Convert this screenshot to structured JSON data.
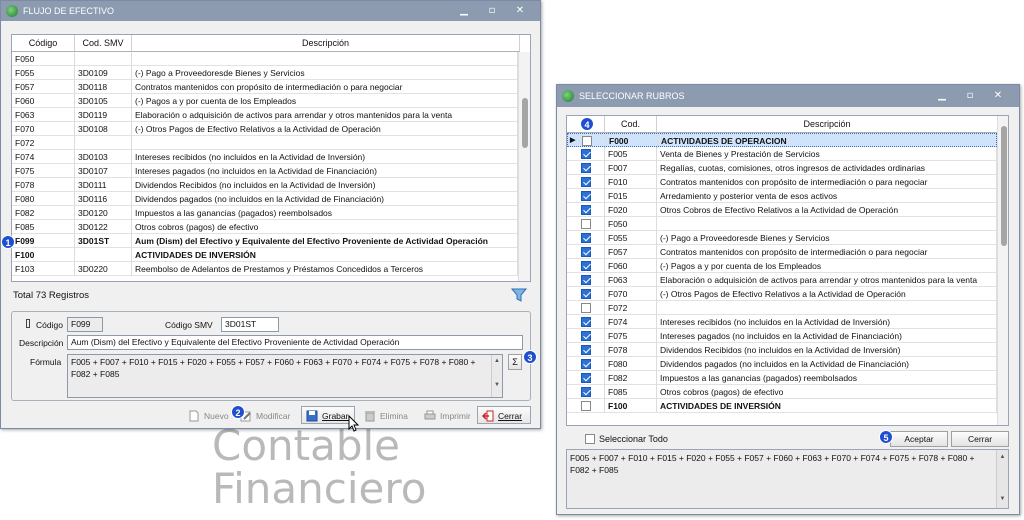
{
  "win1": {
    "title": "FLUJO DE EFECTIVO",
    "columns": [
      "Código",
      "Cod. SMV",
      "Descripción"
    ],
    "rows": [
      {
        "code": "F050",
        "smv": "",
        "desc": "",
        "bold": false
      },
      {
        "code": "F055",
        "smv": "3D0109",
        "desc": "(-) Pago a Proveedoresde Bienes y Servicios",
        "bold": false
      },
      {
        "code": "F057",
        "smv": "3D0118",
        "desc": "Contratos mantenidos con propósito de intermediación o para negociar",
        "bold": false
      },
      {
        "code": "F060",
        "smv": "3D0105",
        "desc": "(-) Pagos a y por cuenta de los Empleados",
        "bold": false
      },
      {
        "code": "F063",
        "smv": "3D0119",
        "desc": "Elaboración o adquisición de activos para arrendar y otros mantenidos para la venta",
        "bold": false
      },
      {
        "code": "F070",
        "smv": "3D0108",
        "desc": "(-) Otros Pagos de Efectivo Relativos a la Actividad de Operación",
        "bold": false
      },
      {
        "code": "F072",
        "smv": "",
        "desc": "",
        "bold": false
      },
      {
        "code": "F074",
        "smv": "3D0103",
        "desc": "Intereses recibidos (no incluidos en la Actividad de Inversión)",
        "bold": false
      },
      {
        "code": "F075",
        "smv": "3D0107",
        "desc": "Intereses pagados (no incluidos en la Actividad de Financiación)",
        "bold": false
      },
      {
        "code": "F078",
        "smv": "3D0111",
        "desc": "Dividendos Recibidos (no incluidos en la Actividad de Inversión)",
        "bold": false
      },
      {
        "code": "F080",
        "smv": "3D0116",
        "desc": "Dividendos pagados (no incluidos en la Actividad de Financiación)",
        "bold": false
      },
      {
        "code": "F082",
        "smv": "3D0120",
        "desc": "Impuestos a las ganancias (pagados) reembolsados",
        "bold": false
      },
      {
        "code": "F085",
        "smv": "3D0122",
        "desc": "Otros cobros (pagos) de efectivo",
        "bold": false
      },
      {
        "code": "F099",
        "smv": "3D01ST",
        "desc": "Aum (Dism) del Efectivo y Equivalente del Efectivo Proveniente de Actividad Operación",
        "bold": true
      },
      {
        "code": "F100",
        "smv": "",
        "desc": "ACTIVIDADES DE INVERSIÓN",
        "bold": true
      },
      {
        "code": "F103",
        "smv": "3D0220",
        "desc": "Reembolso de Adelantos de Prestamos y Préstamos Concedidos a Terceros",
        "bold": false
      }
    ],
    "total": "Total 73 Registros",
    "form": {
      "codigo_label": "Código",
      "codigo_value": "F099",
      "smv_label": "Código SMV",
      "smv_value": "3D01ST",
      "desc_label": "Descripción",
      "desc_value": "Aum (Dism) del Efectivo y Equivalente del Efectivo Proveniente de Actividad Operación",
      "formula_label": "Fórmula",
      "formula_value": "F005 + F007 + F010 + F015 + F020 + F055 + F057 + F060 + F063 + F070 + F074 + F075 + F078 + F080 + F082 + F085",
      "sigma": "Σ"
    },
    "toolbar": {
      "nuevo": "Nuevo",
      "modificar": "Modificar",
      "grabar": "Grabar",
      "elimina": "Elimina",
      "imprimir": "Imprimir",
      "cerrar": "Cerrar"
    }
  },
  "win2": {
    "title": "SELECCIONAR RUBROS",
    "columns": [
      "Cod.",
      "Descripción"
    ],
    "rows": [
      {
        "code": "F000",
        "desc": "ACTIVIDADES DE OPERACION",
        "checked": false,
        "bold": true,
        "selected": true
      },
      {
        "code": "F005",
        "desc": "Venta de Bienes y Prestación de Servicios",
        "checked": true,
        "bold": false,
        "selected": false
      },
      {
        "code": "F007",
        "desc": "Regalías, cuotas,  comisiones, otros ingresos de actividades ordinarias",
        "checked": true,
        "bold": false,
        "selected": false
      },
      {
        "code": "F010",
        "desc": "Contratos mantenidos con propósito de intermediación o para negociar",
        "checked": true,
        "bold": false,
        "selected": false
      },
      {
        "code": "F015",
        "desc": "Arredamiento y posterior venta de esos activos",
        "checked": true,
        "bold": false,
        "selected": false
      },
      {
        "code": "F020",
        "desc": "Otros Cobros de Efectivo Relativos a la Actividad de Operación",
        "checked": true,
        "bold": false,
        "selected": false
      },
      {
        "code": "F050",
        "desc": "",
        "checked": false,
        "bold": false,
        "selected": false
      },
      {
        "code": "F055",
        "desc": "(-) Pago a Proveedoresde Bienes y Servicios",
        "checked": true,
        "bold": false,
        "selected": false
      },
      {
        "code": "F057",
        "desc": "Contratos mantenidos con propósito de intermediación o para negociar",
        "checked": true,
        "bold": false,
        "selected": false
      },
      {
        "code": "F060",
        "desc": "(-) Pagos a y por cuenta de los Empleados",
        "checked": true,
        "bold": false,
        "selected": false
      },
      {
        "code": "F063",
        "desc": "Elaboración o adquisición de activos para arrendar y otros mantenidos para la venta",
        "checked": true,
        "bold": false,
        "selected": false
      },
      {
        "code": "F070",
        "desc": "(-) Otros Pagos de Efectivo Relativos a la Actividad de Operación",
        "checked": true,
        "bold": false,
        "selected": false
      },
      {
        "code": "F072",
        "desc": "",
        "checked": false,
        "bold": false,
        "selected": false
      },
      {
        "code": "F074",
        "desc": "Intereses recibidos (no incluidos en la Actividad de Inversión)",
        "checked": true,
        "bold": false,
        "selected": false
      },
      {
        "code": "F075",
        "desc": "Intereses pagados (no incluidos en la Actividad de Financiación)",
        "checked": true,
        "bold": false,
        "selected": false
      },
      {
        "code": "F078",
        "desc": "Dividendos Recibidos (no incluidos en la Actividad de Inversión)",
        "checked": true,
        "bold": false,
        "selected": false
      },
      {
        "code": "F080",
        "desc": "Dividendos pagados (no incluidos en la Actividad de Financiación)",
        "checked": true,
        "bold": false,
        "selected": false
      },
      {
        "code": "F082",
        "desc": "Impuestos a las ganancias (pagados) reembolsados",
        "checked": true,
        "bold": false,
        "selected": false
      },
      {
        "code": "F085",
        "desc": "Otros cobros (pagos) de efectivo",
        "checked": true,
        "bold": false,
        "selected": false
      },
      {
        "code": "F100",
        "desc": "ACTIVIDADES DE INVERSIÓN",
        "checked": false,
        "bold": true,
        "selected": false
      }
    ],
    "select_all": "Seleccionar Todo",
    "accept": "Aceptar",
    "close": "Cerrar",
    "formula": "F005 + F007 + F010 + F015 + F020 + F055 + F057 + F060 + F063 + F070 + F074 + F075 + F078 + F080 + F082 + F085"
  },
  "badges": [
    "1",
    "2",
    "3",
    "4",
    "5"
  ],
  "watermark": {
    "line1": "Contable",
    "line2": "Financiero"
  },
  "colors": {
    "titlebar": "#8c9bb0",
    "badge": "#1f4fd1",
    "selected_row": "#cfe3fb",
    "check": "#2a72d8"
  }
}
